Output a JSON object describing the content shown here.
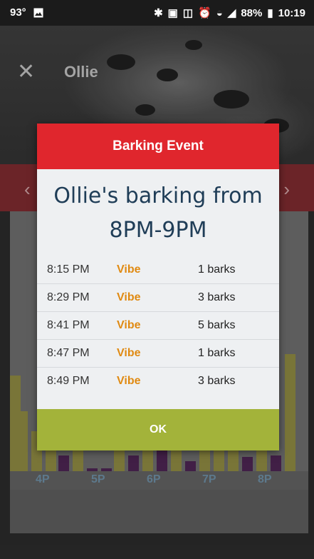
{
  "status_bar": {
    "temp": "93°",
    "battery": "88%",
    "time": "10:19"
  },
  "header": {
    "pet_name": "Ollie"
  },
  "chart_axis": {
    "labels": [
      "4P",
      "5P",
      "6P",
      "7P",
      "8P"
    ]
  },
  "dialog": {
    "title": "Barking Event",
    "message_line1": "Ollie's barking from",
    "message_line2": "8PM-9PM",
    "events": [
      {
        "time": "8:15 PM",
        "stimulus": "Vibe",
        "count": "1 barks"
      },
      {
        "time": "8:29 PM",
        "stimulus": "Vibe",
        "count": "3 barks"
      },
      {
        "time": "8:41 PM",
        "stimulus": "Vibe",
        "count": "5 barks"
      },
      {
        "time": "8:47 PM",
        "stimulus": "Vibe",
        "count": "1 barks"
      },
      {
        "time": "8:49 PM",
        "stimulus": "Vibe",
        "count": "3 barks"
      }
    ],
    "ok_label": "OK"
  },
  "colors": {
    "dialog_header": "#e0262d",
    "ok_button": "#a3b33a",
    "stimulus_text": "#e08a12",
    "message_text": "#1f3d57"
  }
}
